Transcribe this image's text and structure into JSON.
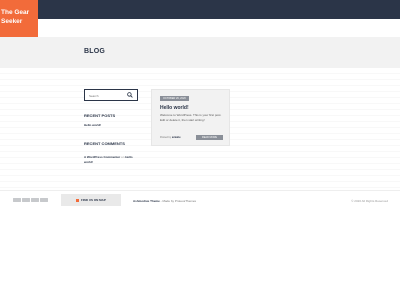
{
  "site": {
    "logo_line1": "The Gear",
    "logo_line2": "Seeker"
  },
  "page": {
    "title": "BLOG"
  },
  "sidebar": {
    "search_placeholder": "Search",
    "recent_posts_title": "RECENT POSTS",
    "recent_posts": [
      "Hello world!"
    ],
    "recent_comments_title": "RECENT COMMENTS",
    "recent_comment": {
      "author": "A WordPress Commenter",
      "on": "on",
      "post": "Hello world!"
    }
  },
  "post": {
    "date": "OCTOBER 26, 2020",
    "title": "Hello world!",
    "excerpt": "Welcome to WordPress. This is your first post. Edit or delete it, then start writing!",
    "meta_prefix": "Posted by",
    "author": "amiatte",
    "read_more": "READ MORE"
  },
  "footer": {
    "payment_icons": [
      "card-icon",
      "card-icon",
      "card-icon",
      "card-icon"
    ],
    "shop_button": "FIND US ON MAP",
    "credit_theme": "Ashmodius Theme",
    "credit_rest": " - Made by ProteusThemes",
    "copyright": "© 2020 All Rights Reserved"
  },
  "colors": {
    "topbar": "#2b3548",
    "accent": "#f26b3a",
    "header_bg": "#f2f2f2"
  }
}
